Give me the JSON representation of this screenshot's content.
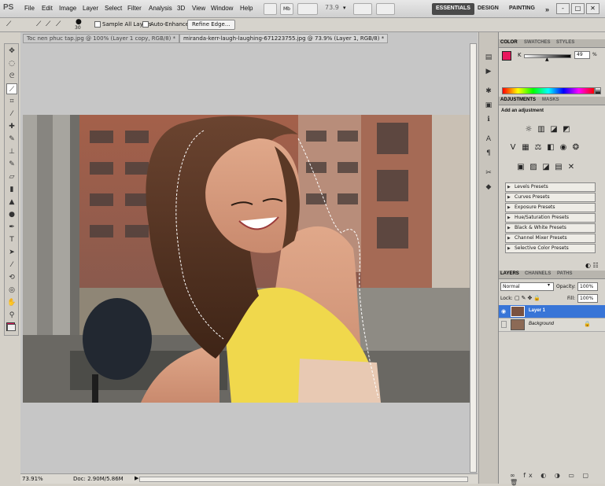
{
  "app": {
    "logo": "PS"
  },
  "menubar": {
    "items": [
      "File",
      "Edit",
      "Image",
      "Layer",
      "Select",
      "Filter",
      "Analysis",
      "3D",
      "View",
      "Window",
      "Help"
    ],
    "zoom": "73.9",
    "workspaces": [
      "ESSENTIALS",
      "DESIGN",
      "PAINTING",
      "»"
    ],
    "window_controls": [
      "-",
      "□",
      "✕"
    ]
  },
  "options": {
    "brush_size": "30",
    "sample_all_layers": "Sample All Layers",
    "auto_enhance": "Auto-Enhance",
    "refine_edge": "Refine Edge..."
  },
  "tabs": [
    "Toc nen phuc tap.jpg @ 100% (Layer 1 copy, RGB/8) *",
    "miranda-kerr-laugh-laughing-671223755.jpg @ 73.9% (Layer 1, RGB/8) *"
  ],
  "status": {
    "zoom": "73.91%",
    "doc": "Doc: 2.90M/5.86M"
  },
  "color_panel": {
    "tabs": [
      "COLOR",
      "SWATCHES",
      "STYLES"
    ],
    "channel": "K",
    "value": "49",
    "unit": "%",
    "fg_color": "#e8175d",
    "bg_color": "#ffffff"
  },
  "adjustments": {
    "tabs": [
      "ADJUSTMENTS",
      "MASKS"
    ],
    "header": "Add an adjustment",
    "presets": [
      "Levels Presets",
      "Curves Presets",
      "Exposure Presets",
      "Hue/Saturation Presets",
      "Black & White Presets",
      "Channel Mixer Presets",
      "Selective Color Presets"
    ]
  },
  "layers": {
    "tabs": [
      "LAYERS",
      "CHANNELS",
      "PATHS"
    ],
    "blend_mode": "Normal",
    "opacity_label": "Opacity:",
    "opacity": "100%",
    "lock_label": "Lock:",
    "fill_label": "Fill:",
    "fill": "100%",
    "items": [
      {
        "name": "Layer 1",
        "selected": true
      },
      {
        "name": "Background",
        "selected": false
      }
    ]
  }
}
